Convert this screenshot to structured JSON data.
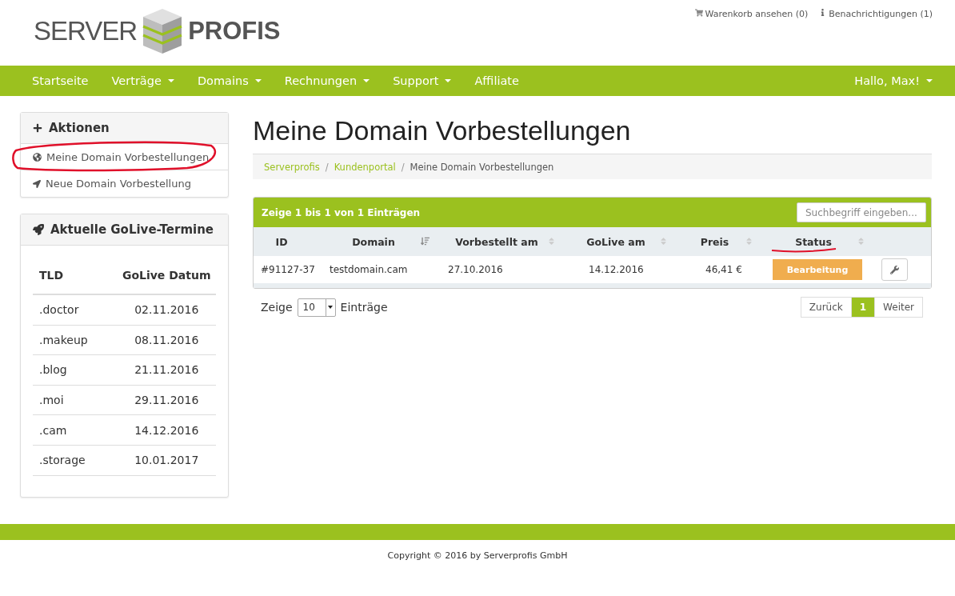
{
  "logo": {
    "left": "SERVER",
    "right": "PROFIS"
  },
  "top_links": [
    {
      "kind": "cart",
      "label": "Warenkorb ansehen (0)"
    },
    {
      "kind": "info",
      "label": "Benachrichtigungen (1)"
    }
  ],
  "nav": {
    "items": [
      {
        "label": "Startseite",
        "dropdown": false
      },
      {
        "label": "Verträge",
        "dropdown": true
      },
      {
        "label": "Domains",
        "dropdown": true
      },
      {
        "label": "Rechnungen",
        "dropdown": true
      },
      {
        "label": "Support",
        "dropdown": true
      },
      {
        "label": "Affiliate",
        "dropdown": false
      }
    ],
    "user": {
      "label": "Hallo, Max!",
      "dropdown": true
    }
  },
  "sidebar": {
    "actions": {
      "title": "Aktionen",
      "items": [
        {
          "kind": "globe",
          "label": "Meine Domain Vorbestellungen",
          "annotated": true
        },
        {
          "kind": "arrow",
          "label": "Neue Domain Vorbestellung",
          "annotated": false
        }
      ]
    },
    "golive": {
      "title": "Aktuelle GoLive-Termine",
      "columns": [
        "TLD",
        "GoLive Datum"
      ],
      "rows": [
        {
          "tld": ".doctor",
          "date": "02.11.2016"
        },
        {
          "tld": ".makeup",
          "date": "08.11.2016"
        },
        {
          "tld": ".blog",
          "date": "21.11.2016"
        },
        {
          "tld": ".moi",
          "date": "29.11.2016"
        },
        {
          "tld": ".cam",
          "date": "14.12.2016"
        },
        {
          "tld": ".storage",
          "date": "10.01.2017"
        }
      ]
    }
  },
  "page_title": "Meine Domain Vorbestellungen",
  "breadcrumb_separator": "/",
  "breadcrumb": [
    {
      "label": "Serverprofis",
      "link": true
    },
    {
      "label": "Kundenportal",
      "link": true
    },
    {
      "label": "Meine Domain Vorbestellungen",
      "link": false
    }
  ],
  "table": {
    "info": "Zeige 1 bis 1 von 1 Einträgen",
    "search": {
      "placeholder": "Suchbegriff eingeben..."
    },
    "columns": [
      {
        "label": "ID",
        "sortable": false,
        "annotated": false
      },
      {
        "label": "Domain",
        "sortable": true,
        "sorted": true,
        "annotated": false
      },
      {
        "label": "Vorbestellt am",
        "sortable": true,
        "sorted": false,
        "annotated": false
      },
      {
        "label": "GoLive am",
        "sortable": true,
        "sorted": false,
        "annotated": false
      },
      {
        "label": "Preis",
        "sortable": true,
        "sorted": false,
        "annotated": false
      },
      {
        "label": "Status",
        "sortable": true,
        "sorted": false,
        "annotated": true
      }
    ],
    "rows": [
      {
        "id": "#91127-37",
        "domain": "testdomain.cam",
        "ordered": "27.10.2016",
        "golive": "14.12.2016",
        "price": "46,41 €",
        "status": "Bearbeitung"
      }
    ]
  },
  "length": {
    "before": "Zeige",
    "value": "10",
    "after": "Einträge"
  },
  "pagination": [
    {
      "label": "Zurück",
      "selected": false
    },
    {
      "label": "1",
      "selected": true
    },
    {
      "label": "Weiter",
      "selected": false
    }
  ],
  "footer": {
    "copyright": "Copyright © 2016 by Serverprofis GmbH"
  }
}
